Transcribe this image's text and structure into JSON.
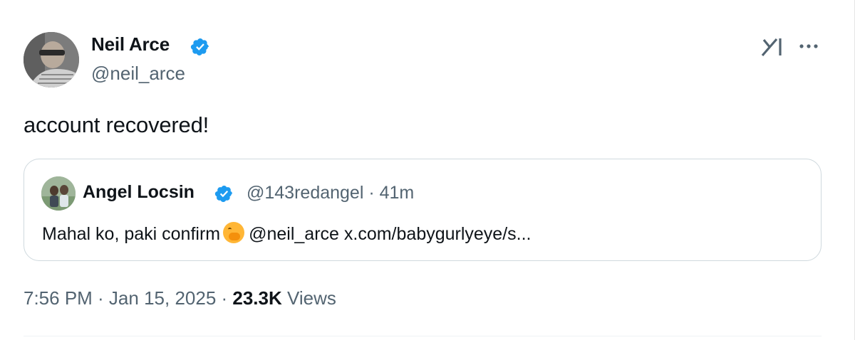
{
  "author": {
    "name": "Neil Arce",
    "handle": "@neil_arce",
    "verified": true
  },
  "tweet": {
    "text": "account recovered!"
  },
  "quoted_tweet": {
    "name": "Angel Locsin",
    "handle_time": "@143redangel · 41m",
    "body_before_emoji": "Mahal ko, paki confirm",
    "emoji": "face-with-hand-over-mouth",
    "body_after_emoji": "@neil_arce x.com/babygurlyeye/s..."
  },
  "meta": {
    "time_date": "7:56 PM · Jan 15, 2025 · ",
    "views_count": "23.3K",
    "views_label": " Views"
  },
  "icons": {
    "grok": "grok-icon",
    "more": "more-icon",
    "verified": "verified-badge-icon"
  },
  "colors": {
    "verified_blue": "#1d9bf0",
    "secondary_text": "#536471",
    "border": "#cfd9de"
  }
}
